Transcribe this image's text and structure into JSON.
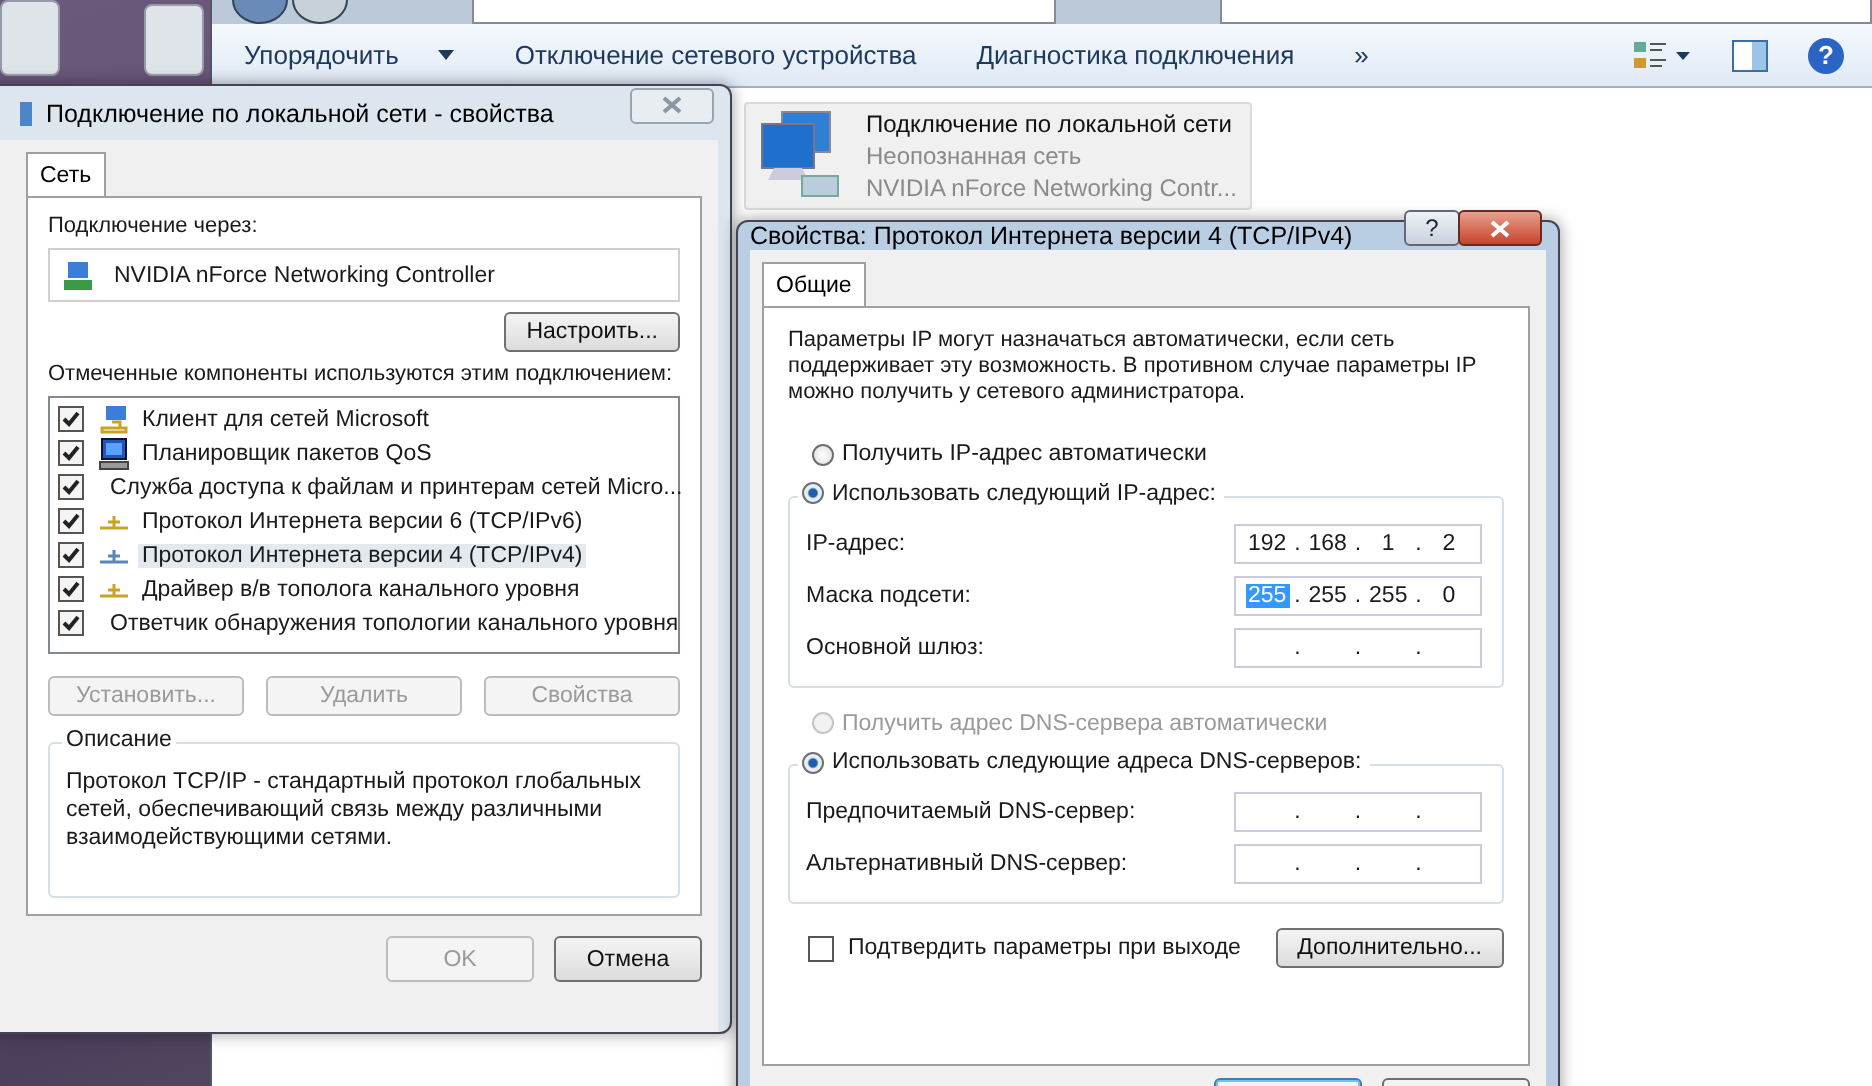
{
  "explorer": {
    "toolbar": [
      {
        "label": "Упорядочить",
        "dropdown": true
      },
      {
        "label": "Отключение сетевого устройства",
        "dropdown": false
      },
      {
        "label": "Диагностика подключения",
        "dropdown": false
      }
    ],
    "overflow": "»",
    "help_icon": "?",
    "connection": {
      "name": "Подключение по локальной сети",
      "status": "Неопознанная сеть",
      "device": "NVIDIA nForce Networking Contr..."
    }
  },
  "lan_dialog": {
    "title": "Подключение по локальной сети - свойства",
    "tabs": [
      {
        "label": "Сеть",
        "selected": true
      }
    ],
    "connect_via_label": "Подключение через:",
    "adapter": "NVIDIA nForce Networking Controller",
    "configure_button": "Настроить...",
    "components_label": "Отмеченные компоненты используются этим подключением:",
    "components": [
      {
        "kind": "client",
        "label": "Клиент для сетей Microsoft",
        "checked": true,
        "selected": false
      },
      {
        "kind": "service",
        "label": "Планировщик пакетов QoS",
        "checked": true,
        "selected": false
      },
      {
        "kind": "service",
        "label": "Служба доступа к файлам и принтерам сетей Micro...",
        "checked": true,
        "selected": false
      },
      {
        "kind": "protocol",
        "label": "Протокол Интернета версии 6 (TCP/IPv6)",
        "checked": true,
        "selected": false
      },
      {
        "kind": "protocol",
        "label": "Протокол Интернета версии 4 (TCP/IPv4)",
        "checked": true,
        "selected": true
      },
      {
        "kind": "protocol",
        "label": "Драйвер в/в тополога канального уровня",
        "checked": true,
        "selected": false
      },
      {
        "kind": "protocol",
        "label": "Ответчик обнаружения топологии канального уровня",
        "checked": true,
        "selected": false
      }
    ],
    "component_buttons": [
      {
        "label": "Установить...",
        "disabled": true
      },
      {
        "label": "Удалить",
        "disabled": true
      },
      {
        "label": "Свойства",
        "disabled": true
      }
    ],
    "description_title": "Описание",
    "description": "Протокол TCP/IP - стандартный протокол глобальных сетей, обеспечивающий связь между различными взаимодействующими сетями.",
    "buttons": [
      {
        "label": "OK",
        "disabled": true
      },
      {
        "label": "Отмена",
        "disabled": false
      }
    ]
  },
  "ipv4_dialog": {
    "title": "Свойства: Протокол Интернета версии 4 (TCP/IPv4)",
    "help_button": "?",
    "tabs": [
      {
        "label": "Общие",
        "selected": true
      }
    ],
    "intro": "Параметры IP могут назначаться автоматически, если сеть поддерживает эту возможность. В противном случае параметры IP можно получить у сетевого администратора.",
    "separator": ".",
    "ip_mode": [
      {
        "label": "Получить IP-адрес автоматически",
        "selected": false,
        "disabled": false
      },
      {
        "label": "Использовать следующий IP-адрес:",
        "selected": true,
        "disabled": false
      }
    ],
    "ip_fields": [
      {
        "label": "IP-адрес:",
        "octets": [
          {
            "text": "192",
            "selected": false
          },
          {
            "text": "168",
            "selected": false
          },
          {
            "text": "1",
            "selected": false
          },
          {
            "text": "2",
            "selected": false
          }
        ]
      },
      {
        "label": "Маска подсети:",
        "octets": [
          {
            "text": "255",
            "selected": true
          },
          {
            "text": "255",
            "selected": false
          },
          {
            "text": "255",
            "selected": false
          },
          {
            "text": "0",
            "selected": false
          }
        ]
      },
      {
        "label": "Основной шлюз:"
      }
    ],
    "dns_mode": [
      {
        "label": "Получить адрес DNS-сервера автоматически",
        "selected": false,
        "disabled": true
      },
      {
        "label": "Использовать следующие адреса DNS-серверов:",
        "selected": true,
        "disabled": false
      }
    ],
    "dns_fields": [
      {
        "label": "Предпочитаемый DNS-сервер:"
      },
      {
        "label": "Альтернативный DNS-сервер:"
      }
    ],
    "validate_checkbox": {
      "label": "Подтвердить параметры при выходе",
      "checked": false
    },
    "advanced_button": "Дополнительно..."
  }
}
